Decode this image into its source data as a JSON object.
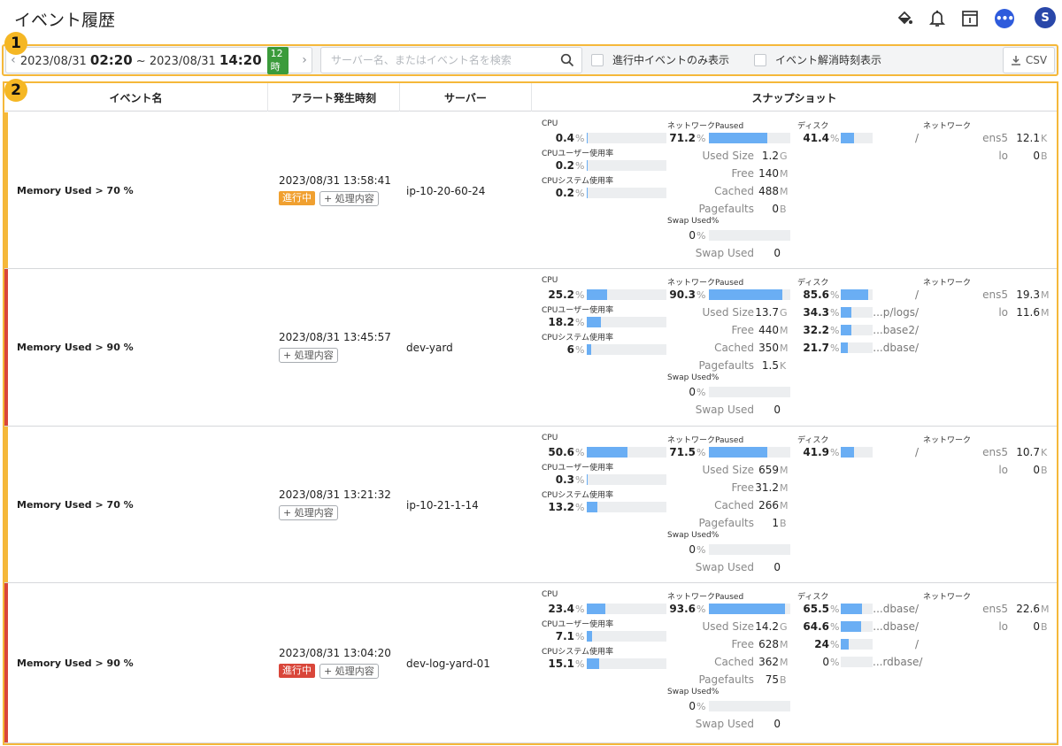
{
  "header": {
    "title": "イベント履歴",
    "icons": [
      "paint-bucket-icon",
      "bell-icon",
      "calendar-icon",
      "chat-icon"
    ],
    "avatar_letter": "S"
  },
  "callouts": [
    "1",
    "2"
  ],
  "toolbar": {
    "date_start": "2023/08/31",
    "time_start": "02:20",
    "separator": "~",
    "date_end": "2023/08/31",
    "time_end": "14:20",
    "range_badge": "12時",
    "search_placeholder": "サーバー名、またはイベント名を検索",
    "search_value": "",
    "check_active_only": "進行中イベントのみ表示",
    "check_resolve_time": "イベント解消時刻表示",
    "csv_label": "CSV"
  },
  "table": {
    "headers": {
      "event_name": "イベント名",
      "alert_time": "アラート発生時刻",
      "server": "サーバー",
      "snapshot": "スナップショット"
    },
    "snapshot_labels": {
      "cpu": "CPU",
      "cpu_user": "CPUユーザー使用率",
      "cpu_sys": "CPUシステム使用率",
      "network_paused": "ネットワークPaused",
      "used_size": "Used Size",
      "free": "Free",
      "cached": "Cached",
      "pagefaults": "Pagefaults",
      "swap_used_pct": "Swap Used%",
      "swap_used": "Swap Used",
      "disk": "ディスク",
      "network": "ネットワーク"
    },
    "handle_label": "+ 処理内容",
    "active_label": "進行中",
    "rows": [
      {
        "event": "Memory Used > 70 %",
        "time": "2023/08/31 13:58:41",
        "active": true,
        "active_color": "#f0a030",
        "stripe_color": "#f5b83a",
        "server": "ip-10-20-60-24",
        "cpu": "0.4",
        "cpu_pct": 0.4,
        "cpu_user": "0.2",
        "cpu_user_pct": 0.2,
        "cpu_sys": "0.2",
        "cpu_sys_pct": 0.2,
        "mem": "71.2",
        "mem_pct": 71.2,
        "used_size": "1.2",
        "used_size_unit": "G",
        "free": "140",
        "free_unit": "M",
        "cached": "488",
        "cached_unit": "M",
        "pagefaults": "0",
        "pagefaults_unit": "B",
        "swap_pct": "0",
        "swap_pct_num": 0,
        "swap_used": "0",
        "disks": [
          {
            "val": "41.4",
            "pct": 41.4,
            "path": "/"
          }
        ],
        "nets": [
          {
            "if": "ens5",
            "val": "12.1",
            "unit": "K"
          },
          {
            "if": "lo",
            "val": "0",
            "unit": "B"
          }
        ]
      },
      {
        "event": "Memory Used > 90 %",
        "time": "2023/08/31 13:45:57",
        "active": false,
        "stripe_color": "#d9463a",
        "server": "dev-yard",
        "cpu": "25.2",
        "cpu_pct": 25.2,
        "cpu_user": "18.2",
        "cpu_user_pct": 18.2,
        "cpu_sys": "6",
        "cpu_sys_pct": 6,
        "mem": "90.3",
        "mem_pct": 90.3,
        "used_size": "13.7",
        "used_size_unit": "G",
        "free": "440",
        "free_unit": "M",
        "cached": "350",
        "cached_unit": "M",
        "pagefaults": "1.5",
        "pagefaults_unit": "K",
        "swap_pct": "0",
        "swap_pct_num": 0,
        "swap_used": "0",
        "disks": [
          {
            "val": "85.6",
            "pct": 85.6,
            "path": "/"
          },
          {
            "val": "34.3",
            "pct": 34.3,
            "path": "...p/logs/"
          },
          {
            "val": "32.2",
            "pct": 32.2,
            "path": "...base2/"
          },
          {
            "val": "21.7",
            "pct": 21.7,
            "path": "...dbase/"
          }
        ],
        "nets": [
          {
            "if": "ens5",
            "val": "19.3",
            "unit": "M"
          },
          {
            "if": "lo",
            "val": "11.6",
            "unit": "M"
          }
        ]
      },
      {
        "event": "Memory Used > 70 %",
        "time": "2023/08/31 13:21:32",
        "active": false,
        "stripe_color": "#f5b83a",
        "server": "ip-10-21-1-14",
        "cpu": "50.6",
        "cpu_pct": 50.6,
        "cpu_user": "0.3",
        "cpu_user_pct": 0.3,
        "cpu_sys": "13.2",
        "cpu_sys_pct": 13.2,
        "mem": "71.5",
        "mem_pct": 71.5,
        "used_size": "659",
        "used_size_unit": "M",
        "free": "31.2",
        "free_unit": "M",
        "cached": "266",
        "cached_unit": "M",
        "pagefaults": "1",
        "pagefaults_unit": "B",
        "swap_pct": "0",
        "swap_pct_num": 0,
        "swap_used": "0",
        "disks": [
          {
            "val": "41.9",
            "pct": 41.9,
            "path": "/"
          }
        ],
        "nets": [
          {
            "if": "ens5",
            "val": "10.7",
            "unit": "K"
          },
          {
            "if": "lo",
            "val": "0",
            "unit": "B"
          }
        ]
      },
      {
        "event": "Memory Used > 90 %",
        "time": "2023/08/31 13:04:20",
        "active": true,
        "active_color": "#d9463a",
        "stripe_color": "#d9463a",
        "server": "dev-log-yard-01",
        "cpu": "23.4",
        "cpu_pct": 23.4,
        "cpu_user": "7.1",
        "cpu_user_pct": 7.1,
        "cpu_sys": "15.1",
        "cpu_sys_pct": 15.1,
        "mem": "93.6",
        "mem_pct": 93.6,
        "used_size": "14.2",
        "used_size_unit": "G",
        "free": "628",
        "free_unit": "M",
        "cached": "362",
        "cached_unit": "M",
        "pagefaults": "75",
        "pagefaults_unit": "B",
        "swap_pct": "0",
        "swap_pct_num": 0,
        "swap_used": "0",
        "disks": [
          {
            "val": "65.5",
            "pct": 65.5,
            "path": "...dbase/"
          },
          {
            "val": "64.6",
            "pct": 64.6,
            "path": "...dbase/"
          },
          {
            "val": "24",
            "pct": 24,
            "path": "/"
          },
          {
            "val": "0",
            "pct": 0,
            "path": "...rdbase/"
          }
        ],
        "nets": [
          {
            "if": "ens5",
            "val": "22.6",
            "unit": "M"
          },
          {
            "if": "lo",
            "val": "0",
            "unit": "B"
          }
        ]
      }
    ]
  }
}
